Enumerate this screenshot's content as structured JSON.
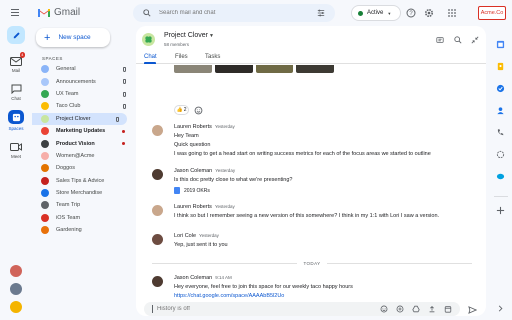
{
  "app": {
    "name": "Gmail",
    "account_badge": "Acme.Co"
  },
  "search": {
    "placeholder": "Search mail and chat"
  },
  "status": {
    "label": "Active",
    "color": "#188038"
  },
  "rail": {
    "items": [
      {
        "label": "Mail",
        "badge": "4",
        "icon": "mail-icon"
      },
      {
        "label": "Chat",
        "icon": "chat-icon"
      },
      {
        "label": "Spaces",
        "icon": "spaces-icon",
        "active": true
      },
      {
        "label": "Meet",
        "icon": "meet-icon"
      }
    ]
  },
  "sidebar": {
    "new_space_label": "New space",
    "heading": "SPACES",
    "items": [
      {
        "label": "General",
        "color": "#8ab4f8",
        "pinned": true
      },
      {
        "label": "Announcements",
        "color": "#a8c7fa",
        "pinned": true
      },
      {
        "label": "UX Team",
        "color": "#34a853",
        "pinned": true
      },
      {
        "label": "Taco Club",
        "color": "#fbbc04",
        "pinned": true
      },
      {
        "label": "Project Clover",
        "color": "#c8e6a0",
        "pinned": true,
        "active": true
      },
      {
        "label": "Marketing Updates",
        "color": "#ea4335",
        "unread": true,
        "bold": true
      },
      {
        "label": "Product Vision",
        "color": "#3c4043",
        "unread": true,
        "bold": true
      },
      {
        "label": "Women@Acme",
        "color": "#f6aea9"
      },
      {
        "label": "Doggos",
        "color": "#e37400"
      },
      {
        "label": "Sales Tips & Advice",
        "color": "#c5221f"
      },
      {
        "label": "Store Merchandise",
        "color": "#1a73e8"
      },
      {
        "label": "Team Trip",
        "color": "#5f6368"
      },
      {
        "label": "iOS Team",
        "color": "#d93025"
      },
      {
        "label": "Gardening",
        "color": "#e8710a"
      }
    ]
  },
  "space": {
    "name": "Project Clover",
    "members": "58 members",
    "tabs": [
      {
        "label": "Chat",
        "active": true
      },
      {
        "label": "Files"
      },
      {
        "label": "Tasks"
      }
    ]
  },
  "reaction": {
    "emoji": "👍",
    "count": "2"
  },
  "messages": [
    {
      "author": "Lauren Roberts",
      "time": "Yesterday",
      "avatar_color": "#c9a78c",
      "lines": [
        "Hey Team",
        "Quick question",
        "I was going to get a head start on writing success metrics for each of the focus areas we started to outline"
      ]
    },
    {
      "author": "Jason Coleman",
      "time": "Yesterday",
      "avatar_color": "#4e3b31",
      "lines": [
        "Is this doc pretty close to what we're presenting?"
      ],
      "attachment": "2019 OKRs"
    },
    {
      "author": "Lauren Roberts",
      "time": "Yesterday",
      "avatar_color": "#c9a78c",
      "lines": [
        "I think so but I remember seeing a new version of this somewhere? I think in my 1:1 with Lori I saw a version."
      ]
    },
    {
      "author": "Lori Cole",
      "time": "Yesterday",
      "avatar_color": "#6d4c41",
      "lines": [
        "Yep, just sent it to you"
      ]
    },
    {
      "author": "Jason Coleman",
      "time": "9:14 AM",
      "avatar_color": "#4e3b31",
      "lines": [
        "Hey everyone, feel free to join this space for our weekly taco happy hours"
      ],
      "link": "https://chat.google.com/space/AAAAbB5l2Uo"
    }
  ],
  "divider_label": "TODAY",
  "composer": {
    "placeholder": "History is off"
  }
}
